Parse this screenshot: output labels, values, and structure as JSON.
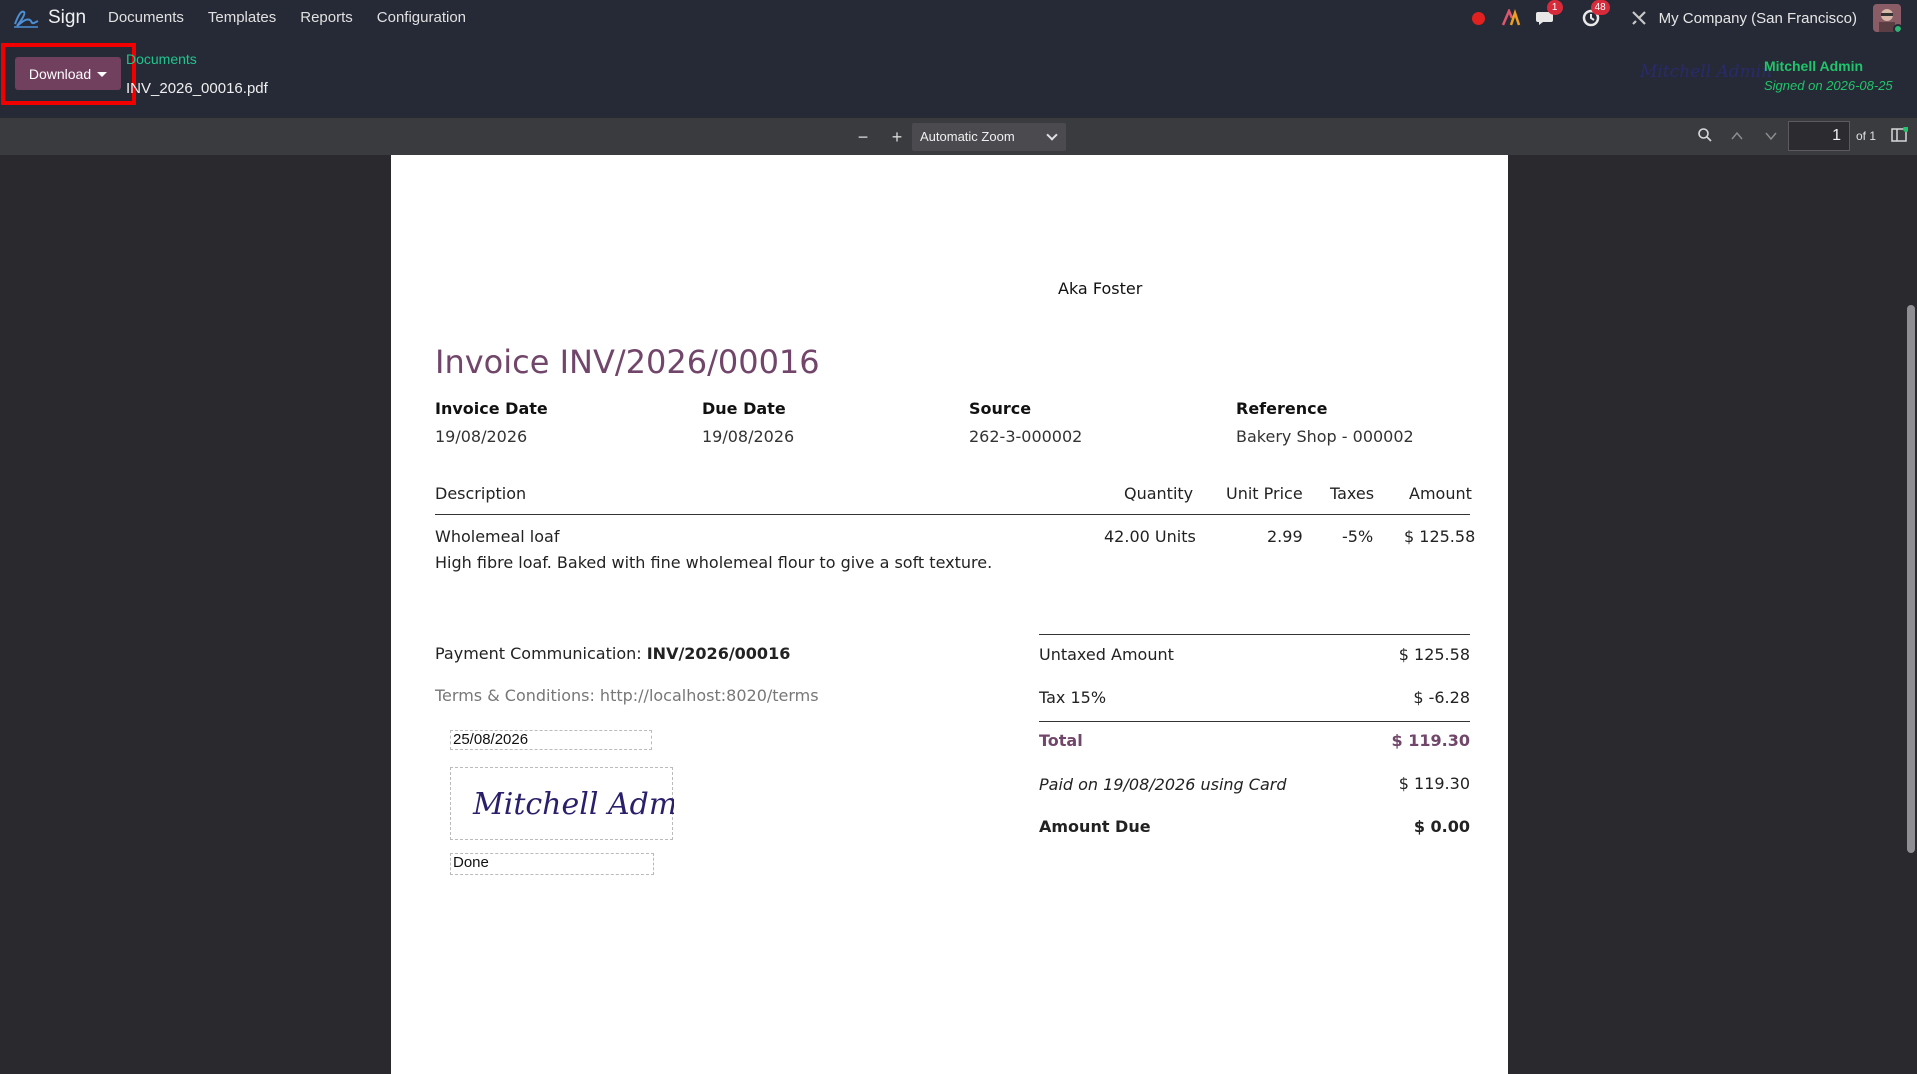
{
  "navbar": {
    "app_name": "Sign",
    "menu": [
      "Documents",
      "Templates",
      "Reports",
      "Configuration"
    ],
    "chat_badge": "1",
    "activity_badge": "48",
    "company": "My Company (San Francisco)"
  },
  "control": {
    "download_label": "Download",
    "breadcrumb_parent": "Documents",
    "file_name": "INV_2026_00016.pdf",
    "signer_signature": "Mitchell Admin",
    "signer_name": "Mitchell Admin",
    "signed_on": "Signed on 2026-08-25"
  },
  "pdf_toolbar": {
    "zoom_out": "−",
    "zoom_in": "+",
    "zoom_value": "Automatic Zoom",
    "page_number": "1",
    "page_total": "of 1"
  },
  "invoice": {
    "company_name": "Aka Foster",
    "title": "Invoice INV/2026/00016",
    "meta": [
      {
        "label": "Invoice Date",
        "value": "19/08/2026"
      },
      {
        "label": "Due Date",
        "value": "19/08/2026"
      },
      {
        "label": "Source",
        "value": "262-3-000002"
      },
      {
        "label": "Reference",
        "value": "Bakery Shop - 000002"
      }
    ],
    "columns": {
      "description": "Description",
      "quantity": "Quantity",
      "unit_price": "Unit Price",
      "taxes": "Taxes",
      "amount": "Amount"
    },
    "line": {
      "product": "Wholemeal loaf",
      "quantity": "42.00 Units",
      "unit_price": "2.99",
      "taxes": "-5%",
      "amount": "$ 125.58",
      "description": "High fibre loaf. Baked with fine wholemeal flour to give a soft texture."
    },
    "payment_communication_label": "Payment Communication: ",
    "payment_communication_value": "INV/2026/00016",
    "terms": "Terms & Conditions: http://localhost:8020/terms",
    "sign_date_field": "25/08/2026",
    "signature_text": "Mitchell Admin",
    "done_field": "Done",
    "totals": {
      "untaxed_label": "Untaxed Amount",
      "untaxed_value": "$ 125.58",
      "tax_label": "Tax 15%",
      "tax_value": "$ -6.28",
      "total_label": "Total",
      "total_value": "$ 119.30",
      "paid_label": "Paid on 19/08/2026 using Card",
      "paid_value": "$ 119.30",
      "due_label": "Amount Due",
      "due_value": "$ 0.00"
    }
  },
  "colors": {
    "accent": "#71405F",
    "breadcrumb": "#21C48C",
    "signed": "#21C46A",
    "highlight": "#F20000",
    "invoice_title": "#71466A"
  }
}
